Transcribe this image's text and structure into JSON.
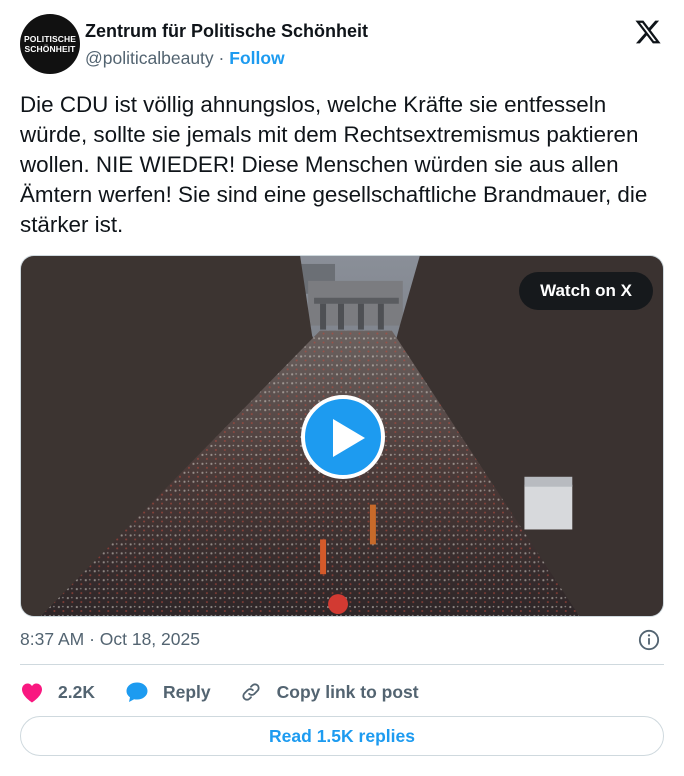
{
  "author": {
    "name": "Zentrum für Politische Schönheit",
    "handle": "@politicalbeauty",
    "separator": "·",
    "follow_label": "Follow",
    "avatar_text_line1": "POLITISCHE",
    "avatar_text_line2": "SCHÖNHEIT"
  },
  "tweet": {
    "text": "Die CDU ist völlig ahnungslos, welche Kräfte sie entfesseln würde, sollte sie jemals mit dem Rechtsextremismus paktieren wollen. NIE WIEDER! Diese Menschen würden sie aus allen Ämtern werfen! Sie sind eine gesellschaftliche Brandmauer, die stärker ist.",
    "timestamp": "8:37 AM · Oct 18, 2025"
  },
  "media": {
    "watch_label": "Watch on X",
    "type": "video"
  },
  "actions": {
    "likes": "2.2K",
    "reply_label": "Reply",
    "copy_link_label": "Copy link to post"
  },
  "read_replies_label": "Read 1.5K replies",
  "colors": {
    "accent": "#1d9bf0",
    "heart": "#f91880",
    "text_secondary": "#536471",
    "border": "#cfd9de"
  },
  "icons": {
    "logo": "x-logo-icon",
    "info": "info-icon",
    "like": "heart-icon",
    "reply": "speech-bubble-icon",
    "copy": "link-icon",
    "play": "play-icon"
  }
}
